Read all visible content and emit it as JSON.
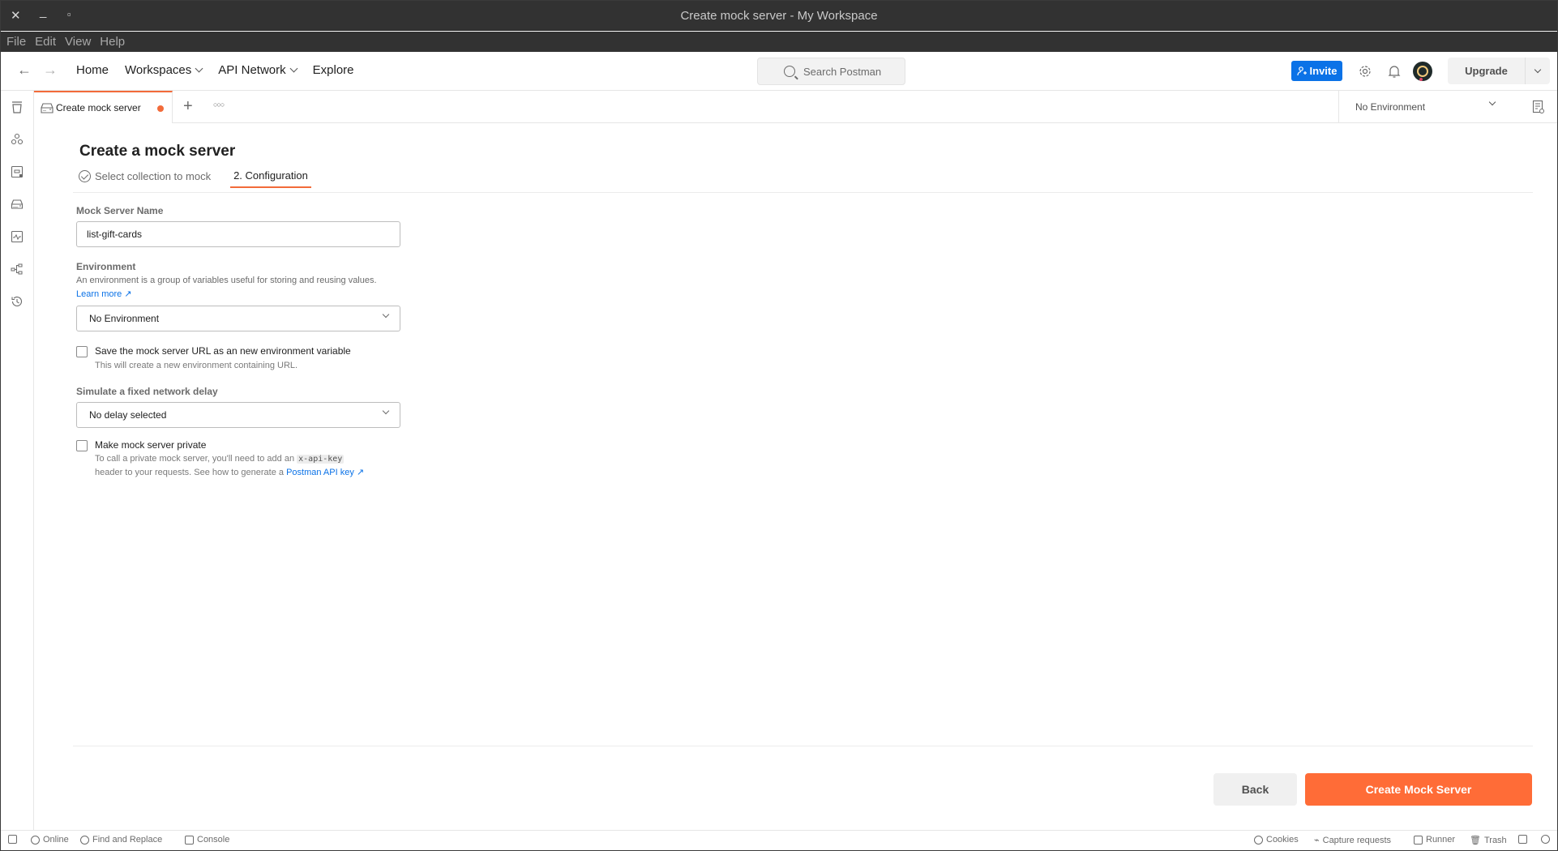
{
  "window": {
    "title": "Create mock server - My Workspace",
    "controls": {
      "close": "✕",
      "minimize": "_",
      "maximize": "▫"
    }
  },
  "menu": [
    "File",
    "Edit",
    "View",
    "Help"
  ],
  "header": {
    "nav": [
      "Home",
      "Workspaces",
      "API Network",
      "Explore"
    ],
    "search_placeholder": "Search Postman",
    "invite_label": "Invite",
    "upgrade_label": "Upgrade"
  },
  "tabs": {
    "active_tab_label": "Create mock server",
    "active_tab_unsaved": true,
    "environment_selector": "No Environment"
  },
  "page": {
    "title": "Create a mock server",
    "steps": [
      {
        "label": "Select collection to mock",
        "status": "completed"
      },
      {
        "label": "2. Configuration",
        "status": "active"
      }
    ],
    "form": {
      "name_label": "Mock Server Name",
      "name_value": "list-gift-cards",
      "environment_label": "Environment",
      "environment_desc": "An environment is a group of variables useful for storing and reusing values.",
      "learn_more": "Learn more ↗",
      "environment_value": "No Environment",
      "save_url_label": "Save the mock server URL as an new environment variable",
      "save_url_desc": "This will create a new environment containing URL.",
      "save_url_checked": false,
      "delay_label": "Simulate a fixed network delay",
      "delay_value": "No delay selected",
      "private_label": "Make mock server private",
      "private_checked": false,
      "private_desc_1": "To call a private mock server, you'll need to add an",
      "private_code": "x-api-key",
      "private_desc_2": "header to your requests. See how to generate a",
      "private_link": "Postman API key ↗"
    },
    "back_label": "Back",
    "create_label": "Create Mock Server"
  },
  "statusbar": {
    "online": "Online",
    "find_replace": "Find and Replace",
    "console": "Console",
    "cookies": "Cookies",
    "capture": "Capture requests",
    "runner": "Runner",
    "trash": "Trash"
  },
  "colors": {
    "accent": "#ff6c37",
    "primary_blue": "#0b72e7"
  }
}
